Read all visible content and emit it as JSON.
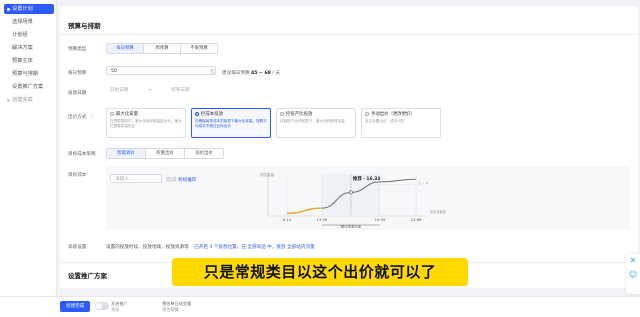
{
  "sidebar": {
    "items": [
      {
        "label": "设置计划"
      },
      {
        "label": "选择场景"
      },
      {
        "label": "计划组"
      },
      {
        "label": "解决方案"
      },
      {
        "label": "预算主体"
      },
      {
        "label": "预算与排期"
      },
      {
        "label": "设置推广方案"
      },
      {
        "label": "创建完成"
      }
    ]
  },
  "section1": {
    "title": "预算与排期",
    "budget_type": {
      "label": "预算类型",
      "options": [
        "每日预算",
        "周预算",
        "不限预算"
      ]
    },
    "daily_budget": {
      "label": "每日预算",
      "value": "50",
      "unit": "元",
      "suggest_prefix": "建议每日预算",
      "suggest_value": "45 ~ 68",
      "suggest_unit": "/ 天"
    },
    "schedule": {
      "label": "投放日期",
      "start_placeholder": "开始日期",
      "end_placeholder": "结束日期"
    },
    "bid_method": {
      "label": "出价方式",
      "cards": [
        {
          "title": "最大化拿量",
          "desc": "在预算限制内，最大化地拿取量能出价，最大化提高拿量机会"
        },
        {
          "title": "控成本投放",
          "desc": "在确保每笔成本的前提下最大化拿量。按照平均成本不超过目标出价"
        },
        {
          "title": "控投产比投放",
          "desc": "控制投产比的前提下，最大化获取转化量"
        },
        {
          "title": "手动出价（更改更好）",
          "desc": "自主设置出价，成本可控"
        }
      ]
    },
    "target_cost": {
      "label": "目标成本策略",
      "options": [
        "智能调价",
        "权重出价",
        "溢价出价"
      ]
    },
    "cost": {
      "label": "目标成本",
      "input_placeholder": "请输入",
      "input_suffix": "元/次",
      "hint": "系统推荐"
    },
    "advanced": {
      "label": "高级设置",
      "text": "设置的投放时段、投放地域、投放资源等",
      "text2": "已开启 4 个投放位置，在 全部商品 中，投放 全部站内流量"
    }
  },
  "chart_data": {
    "type": "line",
    "points": [
      {
        "x": 9.14,
        "y": 1
      },
      {
        "x": 13.06,
        "y": 3
      },
      {
        "x": 16.33,
        "y": 9
      },
      {
        "x": 19.59,
        "y": 13
      },
      {
        "x": 23.66,
        "y": 14
      }
    ],
    "x_ticks": [
      "9.14",
      "13.06",
      "19.59",
      "23.66"
    ],
    "highlight": {
      "x": 16.33,
      "label": "推荐 · 16.33"
    },
    "x_annotation": "建议成本区间",
    "right_annotation": "成本设置参考",
    "y_label": "预估量级",
    "y_note": "1 ~ 4"
  },
  "section2": {
    "title": "设置推广方案"
  },
  "footer": {
    "button": "创建完成",
    "toggle_label": "开启推广",
    "toggle_sub": "关闭",
    "meta1": "预估单日成交量",
    "meta2": "预估预算"
  },
  "caption": "只是常规类目以这个出价就可以了",
  "colors": {
    "accent": "#2d5bff",
    "caption_bg": "#ffd900",
    "curve_orange": "#f5a623"
  }
}
